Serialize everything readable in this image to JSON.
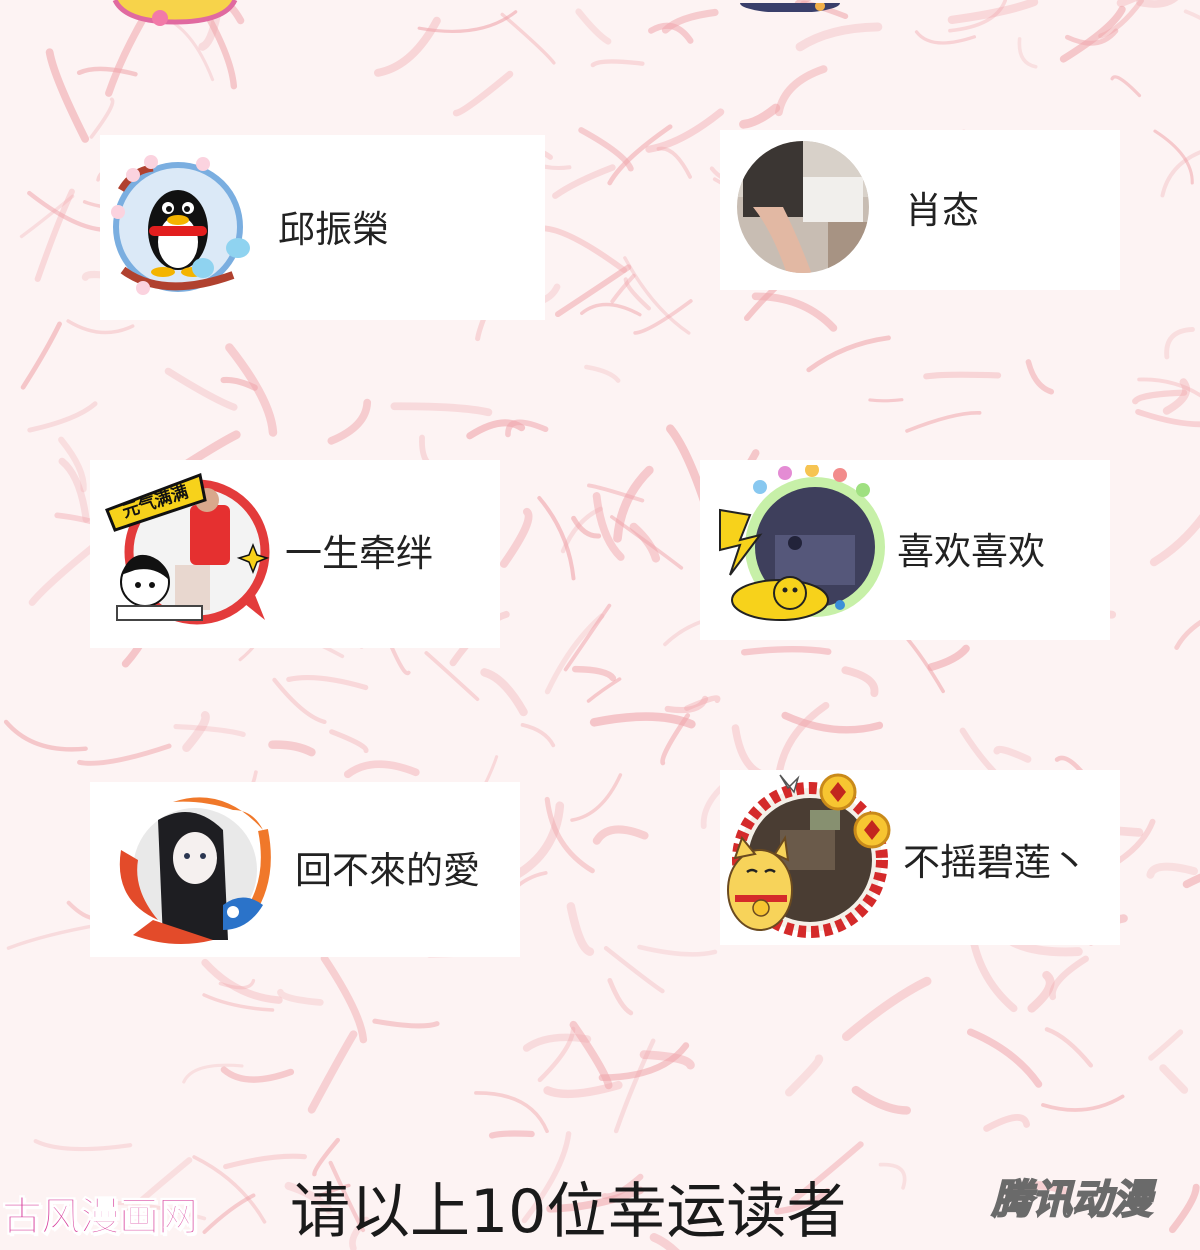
{
  "readers": [
    {
      "name": "邱振榮",
      "avatar_icon": "qq-penguin-sakura-frame-icon"
    },
    {
      "name": "肖态",
      "avatar_icon": "photo-avatar-icon"
    },
    {
      "name": "一生牵绊",
      "avatar_icon": "yuanqi-manman-frame-icon"
    },
    {
      "name": "喜欢喜欢",
      "avatar_icon": "pikachu-frame-icon"
    },
    {
      "name": "回不來的愛",
      "avatar_icon": "koi-fish-frame-icon"
    },
    {
      "name": "不摇碧莲丶",
      "avatar_icon": "lucky-cat-frame-icon"
    }
  ],
  "avatar_frames": {
    "yuanqi_label": "元气满满"
  },
  "caption": "请以上10位幸运读者",
  "watermark_left": "古风漫画网",
  "watermark_right": "腾讯动漫",
  "colors": {
    "background": "#fdf3f3",
    "pattern": "#f0a5ab",
    "card": "#ffffff",
    "name_text": "#222222",
    "watermark_left": "#d63a9a"
  }
}
